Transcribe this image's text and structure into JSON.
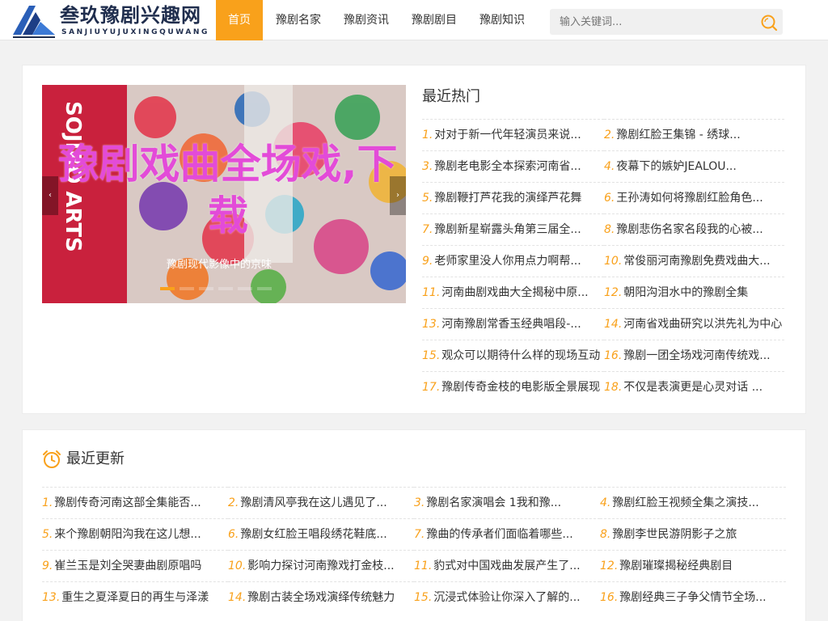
{
  "header": {
    "brand": "叁玖豫剧兴趣网",
    "pinyin": "SANJIUYUJUXINGQUWANG",
    "nav": [
      "首页",
      "豫剧名家",
      "豫剧资讯",
      "豫剧剧目",
      "豫剧知识"
    ],
    "search_placeholder": "输入关键词..."
  },
  "slider": {
    "title": "豫剧戏曲全场戏,下载",
    "caption": "豫剧现代影像中的京味",
    "prev": "‹",
    "next": "›"
  },
  "hot": {
    "title": "最近热门",
    "items": [
      {
        "num": "1.",
        "text": "对对于新一代年轻演员来说..."
      },
      {
        "num": "2.",
        "text": "豫剧红脸王集锦 - 绣球..."
      },
      {
        "num": "3.",
        "text": "豫剧老电影全本探索河南省..."
      },
      {
        "num": "4.",
        "text": "夜幕下的嫉妒JEALOU..."
      },
      {
        "num": "5.",
        "text": "豫剧鞭打芦花我的演绎芦花舞"
      },
      {
        "num": "6.",
        "text": "王孙涛如何将豫剧红脸角色..."
      },
      {
        "num": "7.",
        "text": "豫剧新星崭露头角第三届全..."
      },
      {
        "num": "8.",
        "text": "豫剧悲伤名家名段我的心被..."
      },
      {
        "num": "9.",
        "text": "老师家里没人你用点力啊帮..."
      },
      {
        "num": "10.",
        "text": "常俊丽河南豫剧免费戏曲大..."
      },
      {
        "num": "11.",
        "text": "河南曲剧戏曲大全揭秘中原..."
      },
      {
        "num": "12.",
        "text": "朝阳沟泪水中的豫剧全集"
      },
      {
        "num": "13.",
        "text": "河南豫剧常香玉经典唱段-..."
      },
      {
        "num": "14.",
        "text": "河南省戏曲研究以洪先礼为中心"
      },
      {
        "num": "15.",
        "text": "观众可以期待什么样的现场互动"
      },
      {
        "num": "16.",
        "text": "豫剧一团全场戏河南传统戏..."
      },
      {
        "num": "17.",
        "text": "豫剧传奇金枝的电影版全景展现"
      },
      {
        "num": "18.",
        "text": "不仅是表演更是心灵对话 ..."
      }
    ]
  },
  "latest": {
    "title": "最近更新",
    "items": [
      {
        "num": "1.",
        "text": "豫剧传奇河南这部全集能否..."
      },
      {
        "num": "2.",
        "text": "豫剧清风亭我在这儿遇见了..."
      },
      {
        "num": "3.",
        "text": "豫剧名家演唱会 1我和豫..."
      },
      {
        "num": "4.",
        "text": "豫剧红脸王视频全集之演技..."
      },
      {
        "num": "5.",
        "text": "来个豫剧朝阳沟我在这儿想..."
      },
      {
        "num": "6.",
        "text": "豫剧女红脸王唱段绣花鞋底..."
      },
      {
        "num": "7.",
        "text": "豫曲的传承者们面临着哪些..."
      },
      {
        "num": "8.",
        "text": "豫剧李世民游阴影子之旅"
      },
      {
        "num": "9.",
        "text": "崔兰玉是刘全哭妻曲剧原唱吗"
      },
      {
        "num": "10.",
        "text": "影响力探讨河南豫戏打金枝..."
      },
      {
        "num": "11.",
        "text": "豹式对中国戏曲发展产生了..."
      },
      {
        "num": "12.",
        "text": "豫剧璀璨揭秘经典剧目"
      },
      {
        "num": "13.",
        "text": "重生之夏泽夏日的再生与泽漾"
      },
      {
        "num": "14.",
        "text": "豫剧古装全场戏演绎传统魅力"
      },
      {
        "num": "15.",
        "text": "沉浸式体验让你深入了解的..."
      },
      {
        "num": "16.",
        "text": "豫剧经典三子争父情节全场..."
      }
    ]
  }
}
